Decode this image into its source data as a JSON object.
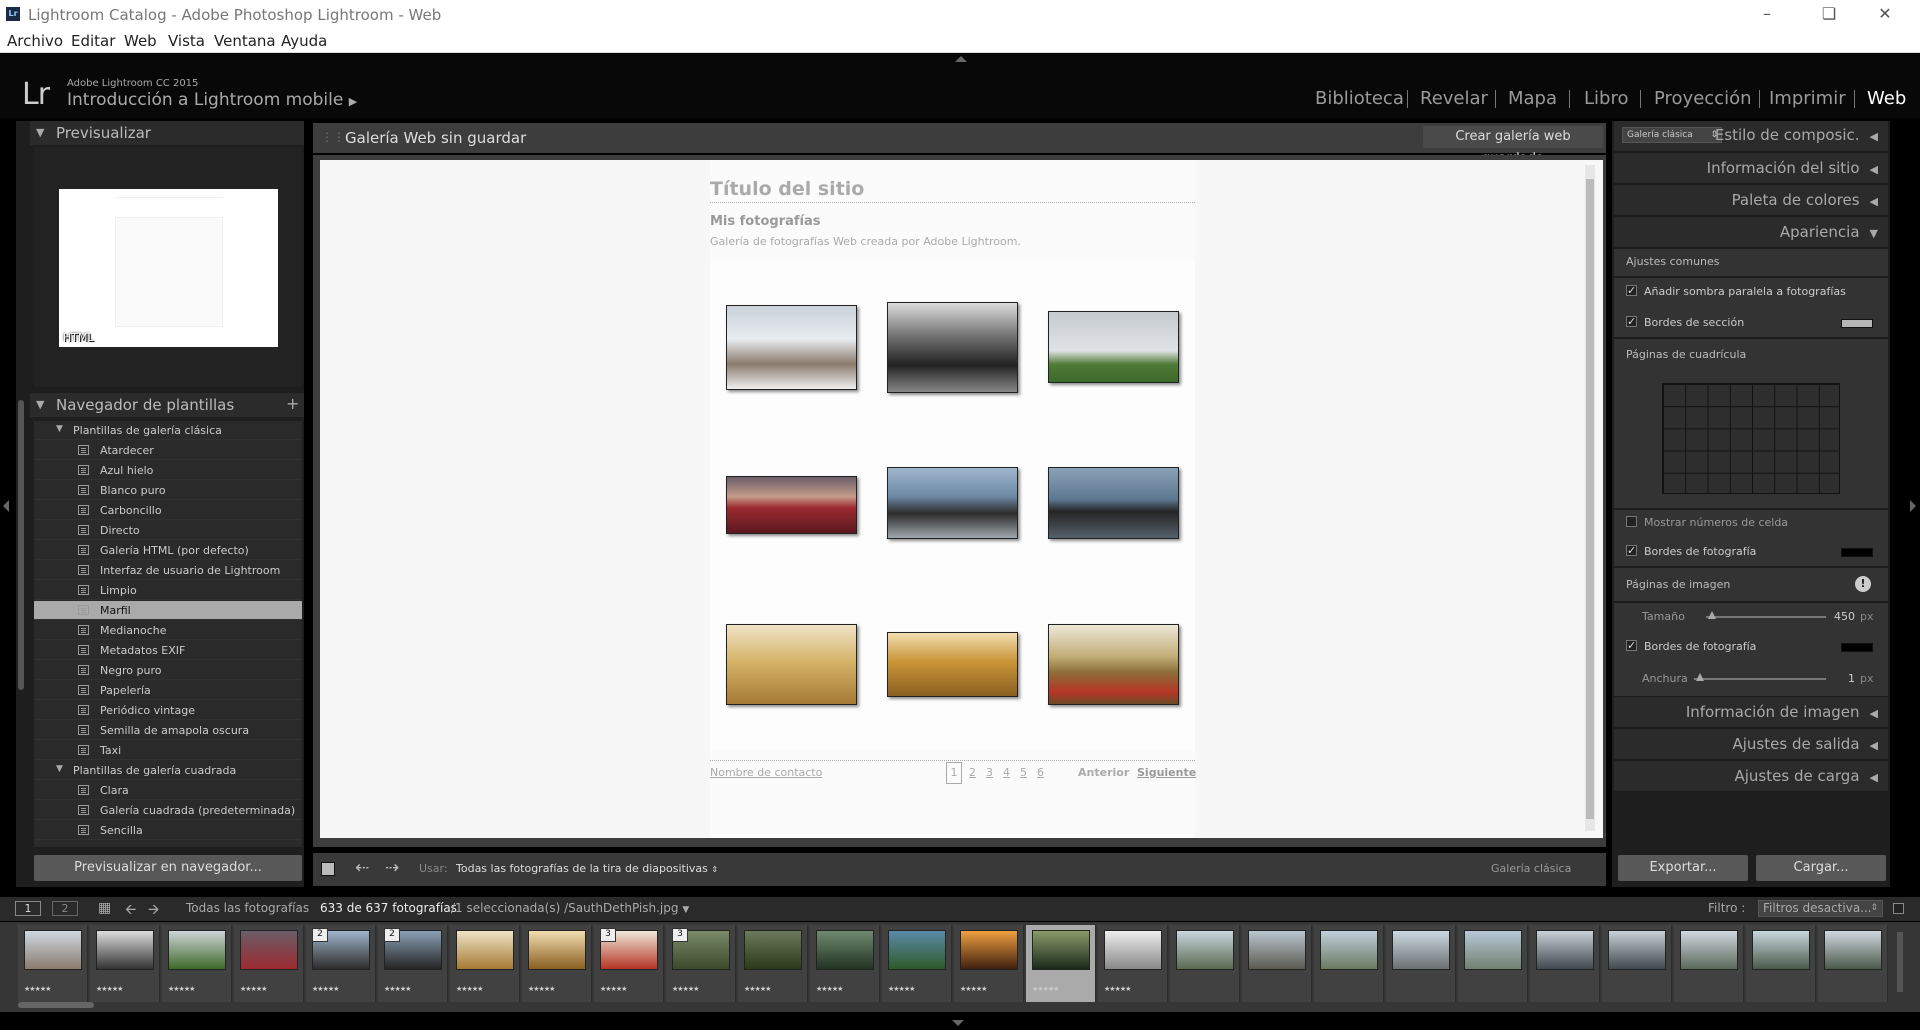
{
  "window": {
    "title": "Lightroom Catalog - Adobe Photoshop Lightroom - Web",
    "app_icon": "Lr"
  },
  "menu": [
    "Archivo",
    "Editar",
    "Web",
    "Vista",
    "Ventana",
    "Ayuda"
  ],
  "identity": {
    "logo": "Lr",
    "product": "Adobe Lightroom CC 2015",
    "plate": "Introducción a Lightroom mobile"
  },
  "modules": [
    "Biblioteca",
    "Revelar",
    "Mapa",
    "Libro",
    "Proyección",
    "Imprimir",
    "Web"
  ],
  "active_module": "Web",
  "left_panel": {
    "preview_title": "Previsualizar",
    "preview_badge": "HTML",
    "template_browser_title": "Navegador de plantillas",
    "folders": [
      {
        "label": "Plantillas de galería clásica",
        "items": [
          "Atardecer",
          "Azul hielo",
          "Blanco puro",
          "Carboncillo",
          "Directo",
          "Galería HTML (por defecto)",
          "Interfaz de usuario de Lightroom",
          "Limpio",
          "Marfil",
          "Medianoche",
          "Metadatos EXIF",
          "Negro puro",
          "Papelería",
          "Periódico vintage",
          "Semilla de amapola oscura",
          "Taxi"
        ]
      },
      {
        "label": "Plantillas de galería cuadrada",
        "items": [
          "Clara",
          "Galería cuadrada (predeterminada)",
          "Sencilla"
        ]
      }
    ],
    "selected_template": "Marfil",
    "preview_browser_button": "Previsualizar en navegador..."
  },
  "center": {
    "gallery_title": "Galería Web sin guardar",
    "create_button": "Crear galería web guardada",
    "site_title": "Título del sitio",
    "collection_title": "Mis fotografías",
    "collection_desc": "Galería de fotografías Web creada por Adobe Lightroom.",
    "contact": "Nombre de contacto",
    "pages": [
      "1",
      "2",
      "3",
      "4",
      "5",
      "6"
    ],
    "prev": "Anterior",
    "next": "Siguiente"
  },
  "toolbar": {
    "use_label": "Usar:",
    "use_value": "Todas las fotografías de la tira de diapositivas",
    "layout_label": "Galería clásica"
  },
  "right_panel": {
    "layout_select": "Galería clásica",
    "layout_style": "Estilo de composic.",
    "sections": [
      "Información del sitio",
      "Paleta de colores",
      "Apariencia"
    ],
    "common_title": "Ajustes comunes",
    "drop_shadow": "Añadir sombra paralela a fotografías",
    "section_borders": "Bordes de sección",
    "grid_pages": "Páginas de cuadrícula",
    "show_cell_numbers": "Mostrar números de celda",
    "photo_borders": "Bordes de fotografía",
    "image_pages": "Páginas de imagen",
    "size_label": "Tamaño",
    "size_value": "450",
    "size_unit": "px",
    "photo_borders_2": "Bordes de fotografía",
    "width_label": "Anchura",
    "width_value": "1",
    "width_unit": "px",
    "sections_after": [
      "Información de imagen",
      "Ajustes de salida",
      "Ajustes de carga"
    ],
    "export_button": "Exportar...",
    "upload_button": "Cargar..."
  },
  "filmstrip": {
    "screen1": "1",
    "screen2": "2",
    "source": "Todas las fotografías",
    "count": "633 de 637 fotografías",
    "selection": "/1 seleccionada(s) /SauthDethPish.jpg",
    "filter_label": "Filtro :",
    "filter_value": "Filtros desactiva...",
    "stack_badges": [
      "2",
      "2",
      "3",
      "3"
    ],
    "stars": "★★★★★"
  },
  "colors": {
    "accent": "#ffffff",
    "panel": "#2b2b2b",
    "selected_row": "#aaaaaa"
  }
}
